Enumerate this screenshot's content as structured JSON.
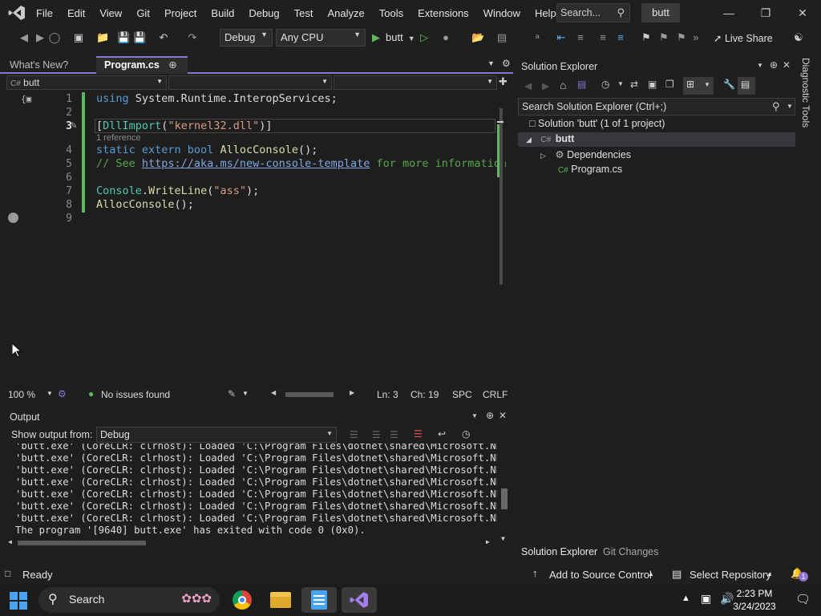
{
  "menubar": {
    "items": [
      "File",
      "Edit",
      "View",
      "Git",
      "Project",
      "Build",
      "Debug",
      "Test",
      "Analyze",
      "Tools",
      "Extensions",
      "Window",
      "Help"
    ],
    "search_placeholder": "Search...",
    "solution_name": "butt"
  },
  "toolbar": {
    "config": "Debug",
    "platform": "Any CPU",
    "run_target": "butt",
    "live_share": "Live Share"
  },
  "editor": {
    "tabs": [
      {
        "label": "What's New?"
      },
      {
        "label": "Program.cs",
        "active": true
      }
    ],
    "nav_project": "butt",
    "ref_hint": "1 reference",
    "lines": [
      {
        "n": "1",
        "text": "using System.Runtime.InteropServices;"
      },
      {
        "n": "2",
        "text": ""
      },
      {
        "n": "3",
        "text": "[DllImport(\"kernel32.dll\")]"
      },
      {
        "n": "4",
        "text": "static extern bool AllocConsole();"
      },
      {
        "n": "5",
        "text": "// See https://aka.ms/new-console-template for more information"
      },
      {
        "n": "6",
        "text": ""
      },
      {
        "n": "7",
        "text": "Console.WriteLine(\"ass\");"
      },
      {
        "n": "8",
        "text": "AllocConsole();"
      },
      {
        "n": "9",
        "text": ""
      }
    ],
    "code": {
      "l1_kw": "using",
      "l1_rest": " System.Runtime.InteropServices;",
      "l3_open": "[",
      "l3_attr": "DllImport",
      "l3_paren": "(",
      "l3_str": "\"kernel32.dll\"",
      "l3_close": ")]",
      "l4_kw": "static extern bool",
      "l4_fn": " AllocConsole",
      "l4_rest": "();",
      "l5_cm1": "// See ",
      "l5_link": "https://aka.ms/new-console-template",
      "l5_cm2": " for more information",
      "l7_cls": "Console",
      "l7_dot": ".",
      "l7_fn": "WriteLine",
      "l7_open": "(",
      "l7_str": "\"ass\"",
      "l7_close": ");",
      "l8_fn": "AllocConsole",
      "l8_rest": "();"
    },
    "status": {
      "zoom": "100 %",
      "issues": "No issues found",
      "line": "Ln: 3",
      "col": "Ch: 19",
      "spc": "SPC",
      "eol": "CRLF"
    }
  },
  "output": {
    "title": "Output",
    "source_label": "Show output from:",
    "source_value": "Debug",
    "lines": [
      "'butt.exe' (CoreCLR: clrhost): Loaded 'C:\\Program Files\\dotnet\\shared\\Microsoft.NETCor",
      "'butt.exe' (CoreCLR: clrhost): Loaded 'C:\\Program Files\\dotnet\\shared\\Microsoft.NETCor",
      "'butt.exe' (CoreCLR: clrhost): Loaded 'C:\\Program Files\\dotnet\\shared\\Microsoft.NETCor",
      "'butt.exe' (CoreCLR: clrhost): Loaded 'C:\\Program Files\\dotnet\\shared\\Microsoft.NETCor",
      "'butt.exe' (CoreCLR: clrhost): Loaded 'C:\\Program Files\\dotnet\\shared\\Microsoft.NETCor",
      "'butt.exe' (CoreCLR: clrhost): Loaded 'C:\\Program Files\\dotnet\\shared\\Microsoft.NETCor",
      "'butt.exe' (CoreCLR: clrhost): Loaded 'C:\\Program Files\\dotnet\\shared\\Microsoft.NETCor",
      "The program '[9640] butt.exe' has exited with code 0 (0x0)."
    ]
  },
  "solution_explorer": {
    "title": "Solution Explorer",
    "search_placeholder": "Search Solution Explorer (Ctrl+;)",
    "solution_label": "Solution 'butt' (1 of 1 project)",
    "project": "butt",
    "dependencies": "Dependencies",
    "file": "Program.cs",
    "tabs": [
      "Solution Explorer",
      "Git Changes"
    ]
  },
  "diagnostic_tools": "Diagnostic Tools",
  "statusbar": {
    "ready": "Ready",
    "add_source": "Add to Source Control",
    "select_repo": "Select Repository",
    "notif_count": "1"
  },
  "taskbar": {
    "search": "Search",
    "time": "2:23 PM",
    "date": "3/24/2023"
  },
  "colors": {
    "accent": "#8b75d6",
    "keyword": "#569cd6",
    "type": "#4ec9b0",
    "string": "#d69d85",
    "comment": "#57a64a"
  }
}
